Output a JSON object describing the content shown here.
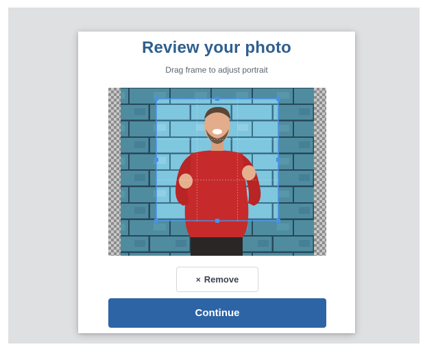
{
  "dialog": {
    "title": "Review your photo",
    "subtitle": "Drag frame to adjust portrait"
  },
  "photo": {
    "has_crop_frame": true
  },
  "actions": {
    "remove_icon": "×",
    "remove_label": "Remove",
    "continue_label": "Continue"
  },
  "colors": {
    "title": "#2e5f8e",
    "primary_button": "#2d64a6",
    "crop_frame": "#4a90e2",
    "backdrop": "#dfe0e2"
  }
}
